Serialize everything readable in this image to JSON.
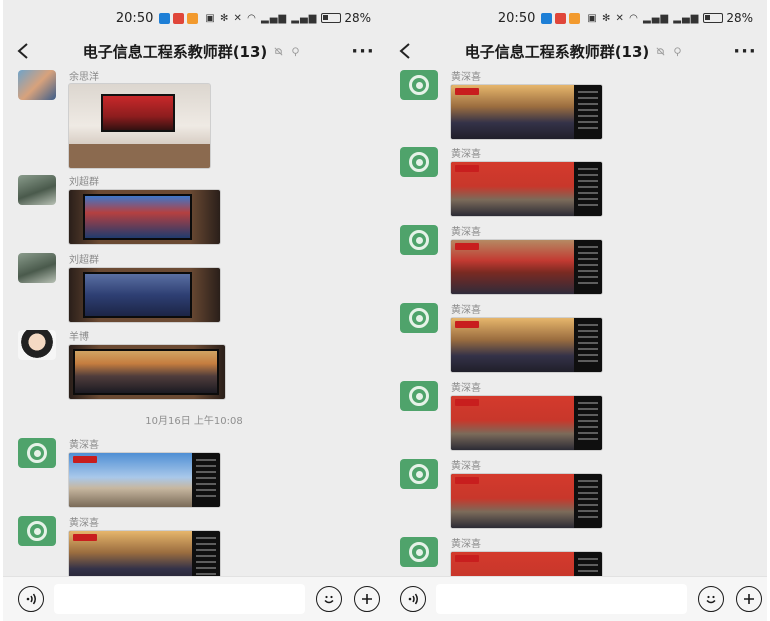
{
  "status_bar": {
    "time": "20:50",
    "battery": "28%"
  },
  "chat_header": {
    "title": "电子信息工程系教师群(13)"
  },
  "left_screen": {
    "senders": [
      "余思洋",
      "刘超群",
      "刘超群",
      "羊博",
      "黄深喜",
      "黄深喜"
    ],
    "timestamp": "10月16日 上午10:08"
  },
  "right_screen": {
    "senders": [
      "黄深喜",
      "黄深喜",
      "黄深喜",
      "黄深喜",
      "黄深喜",
      "黄深喜",
      "黄深喜"
    ]
  },
  "input_bar": {
    "placeholder": ""
  },
  "icons": [
    "back-icon",
    "mute-icon",
    "pin-icon",
    "more-icon",
    "voice-icon",
    "emoji-icon",
    "plus-icon"
  ],
  "colors": {
    "chat_bg": "#ededed",
    "avatar_green": "#4fa36b",
    "input_bg": "#f6f6f6"
  }
}
